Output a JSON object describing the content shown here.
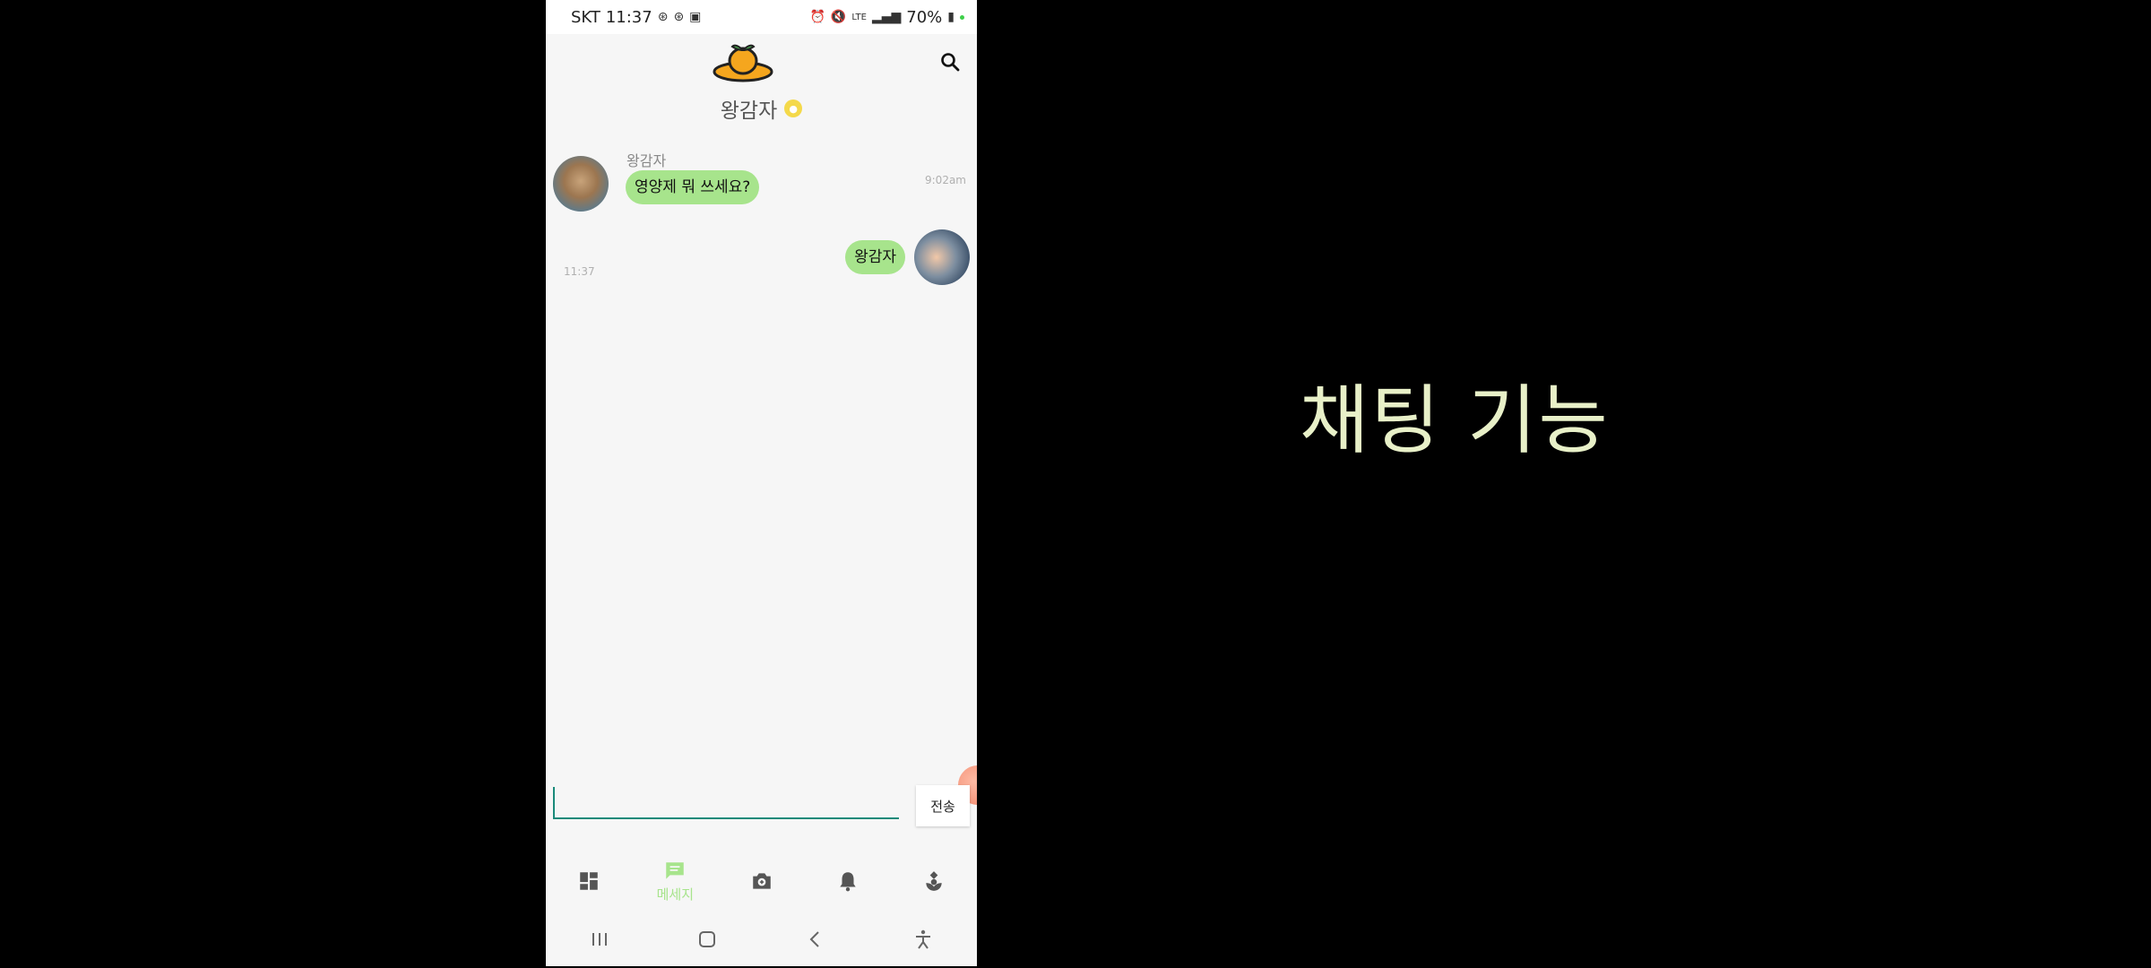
{
  "status_bar": {
    "carrier": "SKT",
    "time": "11:37",
    "network": "LTE",
    "battery": "70%"
  },
  "header": {
    "chat_title": "왕감자"
  },
  "messages": [
    {
      "direction": "incoming",
      "sender": "왕감자",
      "text": "영양제 뭐 쓰세요?",
      "time": "9:02am"
    },
    {
      "direction": "outgoing",
      "text": "왕감자",
      "time": "11:37"
    }
  ],
  "composer": {
    "input_value": "",
    "send_label": "전송"
  },
  "bottom_nav": {
    "items": [
      {
        "icon": "dashboard-icon",
        "label": ""
      },
      {
        "icon": "message-icon",
        "label": "메세지",
        "active": true
      },
      {
        "icon": "camera-icon",
        "label": ""
      },
      {
        "icon": "bell-icon",
        "label": ""
      },
      {
        "icon": "plant-icon",
        "label": ""
      }
    ]
  },
  "caption": "채팅 기능",
  "colors": {
    "bubble": "#a7e48c",
    "accent": "#1a8a7a",
    "caption": "#e8f0c8"
  }
}
